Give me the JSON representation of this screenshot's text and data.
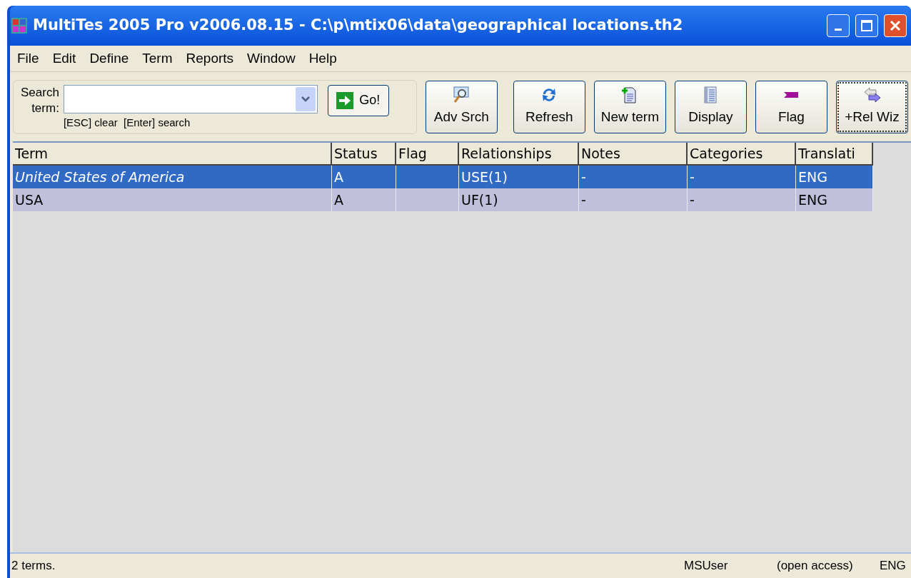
{
  "window": {
    "title": "MultiTes 2005 Pro v2006.08.15 - C:\\p\\mtix06\\data\\geographical locations.th2"
  },
  "menu": [
    "File",
    "Edit",
    "Define",
    "Term",
    "Reports",
    "Window",
    "Help"
  ],
  "search": {
    "label_1": "Search",
    "label_2": "term:",
    "hint": "[ESC] clear  [Enter] search",
    "go": "Go!"
  },
  "toolbar": [
    {
      "label": "Adv Srch",
      "kind": "search",
      "focused": false
    },
    {
      "label": "Refresh",
      "kind": "refresh",
      "focused": false
    },
    {
      "label": "New term",
      "kind": "new",
      "focused": false
    },
    {
      "label": "Display",
      "kind": "display",
      "focused": false
    },
    {
      "label": "Flag",
      "kind": "flag",
      "focused": false
    },
    {
      "label": "+Rel Wiz",
      "kind": "arrows",
      "focused": true
    }
  ],
  "table": {
    "columns": [
      "Term",
      "Status",
      "Flag",
      "Relationships",
      "Notes",
      "Categories",
      "Translati"
    ],
    "rows": [
      {
        "selected": true,
        "italic": true,
        "cells": [
          "United States of America",
          "A",
          "",
          "USE(1)",
          "-",
          "-",
          "ENG"
        ]
      },
      {
        "selected": false,
        "italic": false,
        "cells": [
          "USA",
          "A",
          "",
          "UF(1)",
          "-",
          "-",
          "ENG"
        ]
      }
    ]
  },
  "status_bar": {
    "message": "2 terms.",
    "user": "MSUser",
    "access": "(open access)",
    "language": "ENG"
  }
}
